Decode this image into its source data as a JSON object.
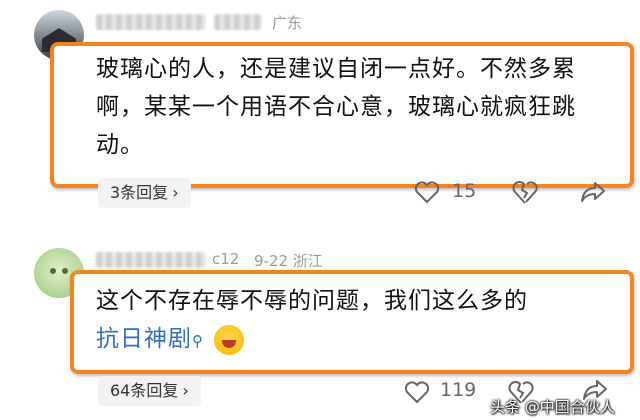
{
  "comments": [
    {
      "location": "广东",
      "text": "玻璃心的人，还是建议自闭一点好。不然多累啊，某某一个用语不合心意，玻璃心就疯狂跳动。",
      "replies_label": "3条回复",
      "likes": "15"
    },
    {
      "meta": "9-22 浙江",
      "username_partial": "c12",
      "text": "这个不存在辱不辱的问题，我们这么多的",
      "link_text": "抗日神剧",
      "replies_label": "64条回复",
      "likes": "119"
    }
  ],
  "watermark": "头条 @中国合伙人",
  "colors": {
    "highlight": "#f5841f",
    "link": "#2f6fc9"
  }
}
